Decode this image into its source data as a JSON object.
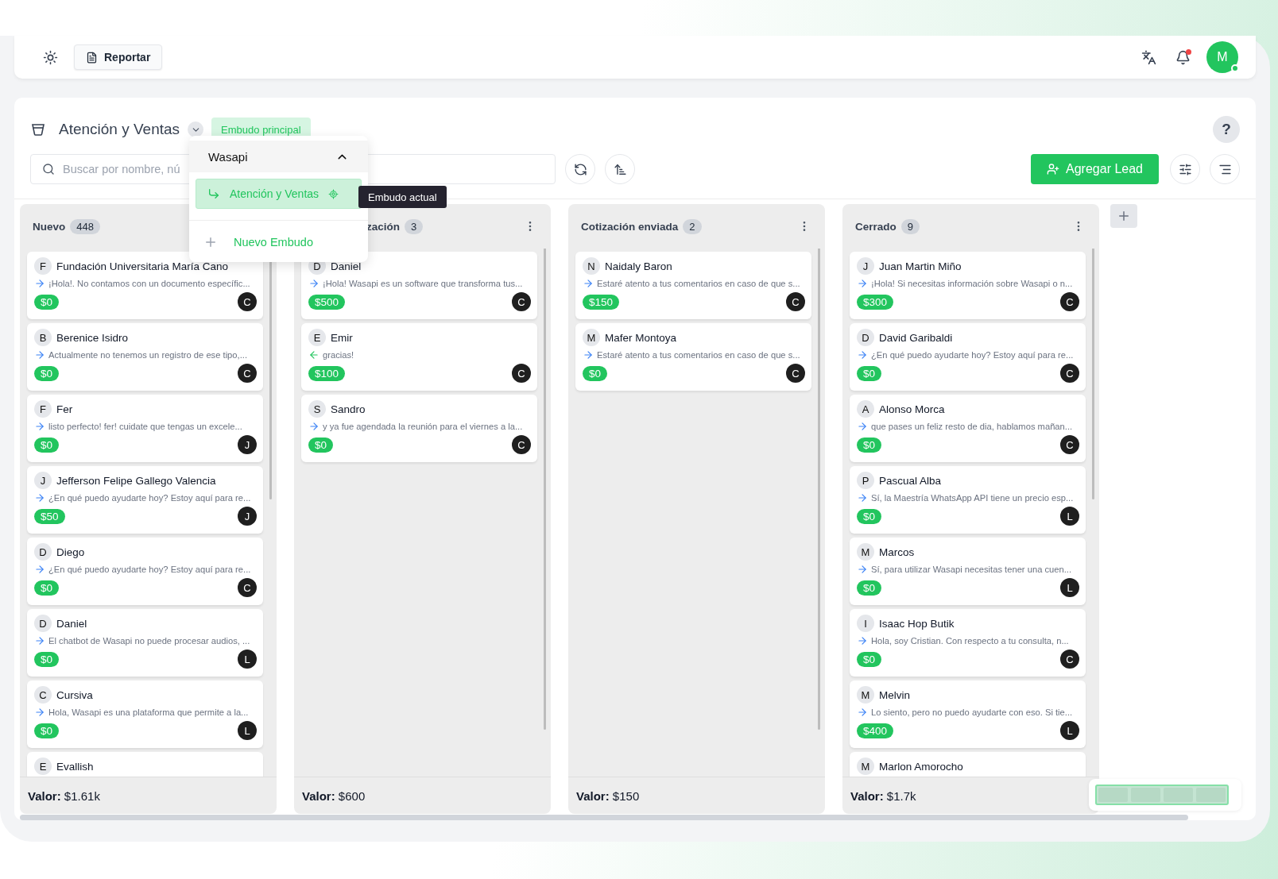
{
  "topbar": {
    "report_button": "Reportar",
    "avatar": {
      "initial": "M",
      "online": true
    },
    "notifications": {
      "unread": true
    }
  },
  "pipeline": {
    "title": "Atención y Ventas",
    "badge": "Embudo principal",
    "help": "?"
  },
  "toolbar": {
    "search": {
      "placeholder": "Buscar por nombre, nú"
    },
    "add_button": "Agregar Lead"
  },
  "dropdown": {
    "group": "Wasapi",
    "expanded": true,
    "items": [
      {
        "label": "Atención y Ventas",
        "selected": true
      }
    ],
    "new_item": "Nuevo Embudo",
    "tooltip": "Embudo actual"
  },
  "columns": [
    {
      "title": "Nuevo",
      "count": "448",
      "title_covered": false,
      "total": "**Valor:** $1.61k",
      "cards": [
        {
          "initial": "F",
          "name": "Fundación Universitaria María Cano",
          "incoming": false,
          "message": "¡Hola!. No contamos con un documento específic...",
          "amount": "$0",
          "agent": "C"
        },
        {
          "initial": "B",
          "name": "Berenice Isidro",
          "incoming": false,
          "message": "Actualmente no tenemos un registro de ese tipo,...",
          "amount": "$0",
          "agent": "C"
        },
        {
          "initial": "F",
          "name": "Fer",
          "incoming": false,
          "message": "listo perfecto! fer! cuidate que tengas un excele...",
          "amount": "$0",
          "agent": "J"
        },
        {
          "initial": "J",
          "name": "Jefferson Felipe Gallego Valencia",
          "incoming": false,
          "message": "¿En qué puedo ayudarte hoy? Estoy aquí para re...",
          "amount": "$50",
          "agent": "J"
        },
        {
          "initial": "D",
          "name": "Diego",
          "incoming": false,
          "message": "¿En qué puedo ayudarte hoy? Estoy aquí para re...",
          "amount": "$0",
          "agent": "C"
        },
        {
          "initial": "D",
          "name": "Daniel",
          "incoming": false,
          "message": "El chatbot de Wasapi no puede procesar audios, ...",
          "amount": "$0",
          "agent": "L"
        },
        {
          "initial": "C",
          "name": "Cursiva",
          "incoming": false,
          "message": "Hola, Wasapi es una plataforma que permite a la...",
          "amount": "$0",
          "agent": "L"
        },
        {
          "initial": "E",
          "name": "Evallish"
        }
      ]
    },
    {
      "title": "zación",
      "count": "3",
      "title_covered": true,
      "total": "**Valor:** $600",
      "cards": [
        {
          "initial": "D",
          "name": "Daniel",
          "incoming": false,
          "message": "¡Hola! Wasapi es un software que transforma tus...",
          "amount": "$500",
          "agent": "C"
        },
        {
          "initial": "E",
          "name": "Emir",
          "incoming": true,
          "message": "gracias!",
          "amount": "$100",
          "agent": "C"
        },
        {
          "initial": "S",
          "name": "Sandro",
          "incoming": false,
          "message": "y ya fue agendada la reunión para el viernes a la...",
          "amount": "$0",
          "agent": "C"
        }
      ]
    },
    {
      "title": "Cotización enviada",
      "count": "2",
      "title_covered": false,
      "total": "**Valor:** $150",
      "cards": [
        {
          "initial": "N",
          "name": "Naidaly Baron",
          "incoming": false,
          "message": "Estaré atento a tus comentarios en caso de que s...",
          "amount": "$150",
          "agent": "C"
        },
        {
          "initial": "M",
          "name": "Mafer Montoya",
          "incoming": false,
          "message": "Estaré atento a tus comentarios en caso de que s...",
          "amount": "$0",
          "agent": "C"
        }
      ]
    },
    {
      "title": "Cerrado",
      "count": "9",
      "title_covered": false,
      "total": "**Valor:** $1.7k",
      "cards": [
        {
          "initial": "J",
          "name": "Juan Martin Miño",
          "incoming": false,
          "message": "¡Hola! Si necesitas información sobre Wasapi o n...",
          "amount": "$300",
          "agent": "C"
        },
        {
          "initial": "D",
          "name": "David Garibaldi",
          "incoming": false,
          "message": "¿En qué puedo ayudarte hoy? Estoy aquí para re...",
          "amount": "$0",
          "agent": "C"
        },
        {
          "initial": "A",
          "name": "Alonso Morca",
          "incoming": false,
          "message": "que pases un feliz resto de dia, hablamos mañan...",
          "amount": "$0",
          "agent": "C"
        },
        {
          "initial": "P",
          "name": "Pascual Alba",
          "incoming": false,
          "message": "Sí, la Maestría WhatsApp API tiene un precio esp...",
          "amount": "$0",
          "agent": "L"
        },
        {
          "initial": "M",
          "name": "Marcos",
          "incoming": false,
          "message": "Sí, para utilizar Wasapi necesitas tener una cuen...",
          "amount": "$0",
          "agent": "L"
        },
        {
          "initial": "I",
          "name": "Isaac Hop Butik",
          "incoming": false,
          "message": "Hola, soy Cristian. Con respecto a tu consulta, n...",
          "amount": "$0",
          "agent": "C"
        },
        {
          "initial": "M",
          "name": "Melvin",
          "incoming": false,
          "message": "Lo siento, pero no puedo ayudarte con eso. Si tie...",
          "amount": "$400",
          "agent": "L"
        },
        {
          "initial": "M",
          "name": "Marlon Amorocho"
        }
      ]
    }
  ]
}
